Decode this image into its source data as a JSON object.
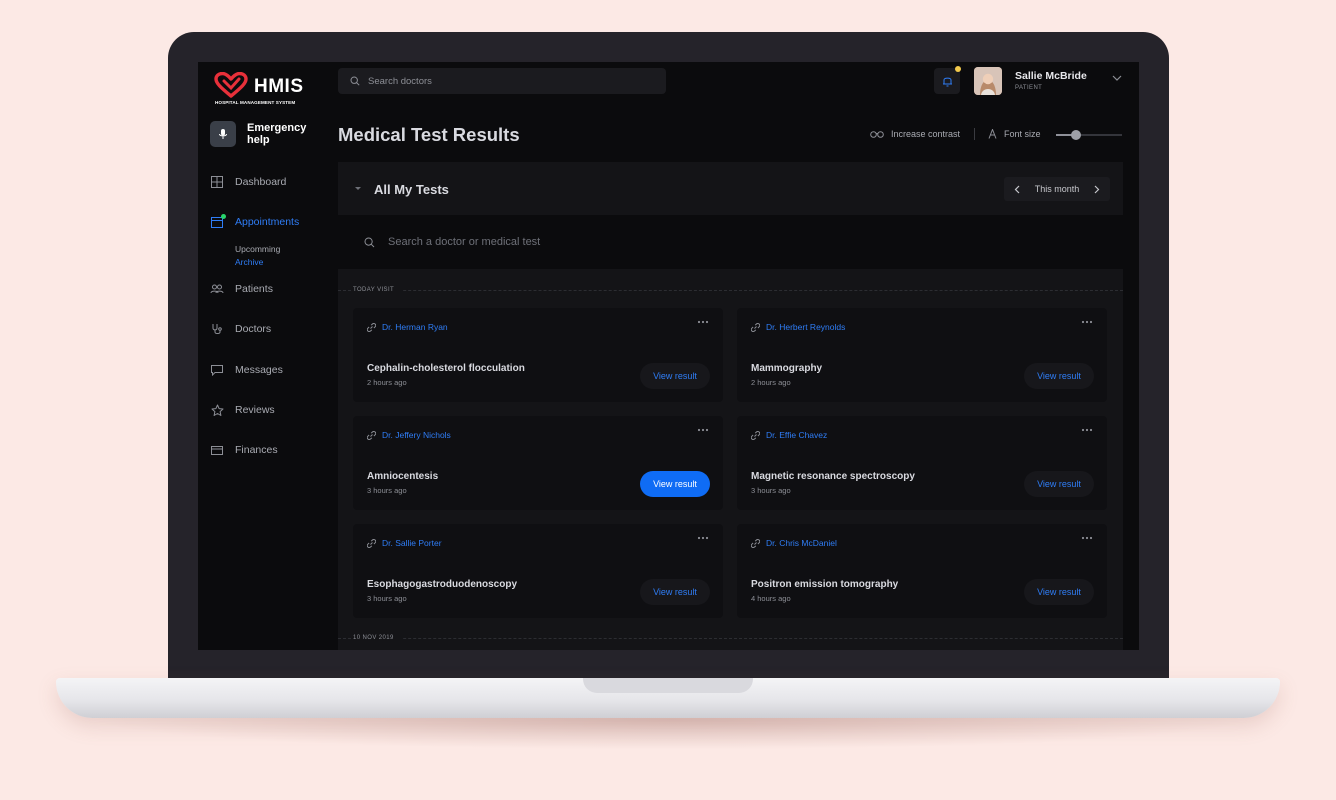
{
  "brand": {
    "name": "HMIS",
    "subtitle": "HOSPITAL MANAGEMENT SYSTEM",
    "accent": "#e8303a"
  },
  "sidebar": {
    "emergency_label": "Emergency help",
    "items": [
      {
        "label": "Dashboard",
        "icon": "grid-icon"
      },
      {
        "label": "Appointments",
        "icon": "calendar-icon",
        "active": true
      },
      {
        "label": "Patients",
        "icon": "users-icon"
      },
      {
        "label": "Doctors",
        "icon": "stethoscope-icon"
      },
      {
        "label": "Messages",
        "icon": "chat-icon"
      },
      {
        "label": "Reviews",
        "icon": "star-icon"
      },
      {
        "label": "Finances",
        "icon": "wallet-icon"
      }
    ],
    "sub_items": [
      {
        "label": "Upcomming"
      },
      {
        "label": "Archive",
        "active": true
      }
    ]
  },
  "header": {
    "search_placeholder": "Search doctors",
    "user_name": "Sallie McBride",
    "user_role": "PATIENT"
  },
  "page": {
    "title": "Medical Test Results",
    "contrast_label": "Increase contrast",
    "font_size_label": "Font size",
    "font_size_level": 0.3
  },
  "panel": {
    "title": "All My Tests",
    "month_label": "This month",
    "search_placeholder": "Search a doctor or medical test",
    "section_today": "TODAY VISIT",
    "section_next": "10 NOV 2019"
  },
  "tests": [
    {
      "doctor": "Dr. Herman Ryan",
      "test": "Cephalin-cholesterol flocculation",
      "time": "2 hours ago",
      "button": "View result",
      "primary": false
    },
    {
      "doctor": "Dr. Herbert Reynolds",
      "test": "Mammography",
      "time": "2 hours ago",
      "button": "View result",
      "primary": false
    },
    {
      "doctor": "Dr. Jeffery Nichols",
      "test": "Amniocentesis",
      "time": "3 hours ago",
      "button": "View result",
      "primary": true
    },
    {
      "doctor": "Dr. Effie Chavez",
      "test": "Magnetic resonance spectroscopy",
      "time": "3 hours ago",
      "button": "View result",
      "primary": false
    },
    {
      "doctor": "Dr. Sallie Porter",
      "test": "Esophagogastroduodenoscopy",
      "time": "3 hours ago",
      "button": "View result",
      "primary": false
    },
    {
      "doctor": "Dr. Chris McDaniel",
      "test": "Positron emission tomography",
      "time": "4 hours ago",
      "button": "View result",
      "primary": false
    }
  ],
  "colors": {
    "accent_blue": "#2f7df6",
    "primary_button": "#0f6cf5",
    "notification_dot": "#f2c94c",
    "online_dot": "#29d46a"
  }
}
